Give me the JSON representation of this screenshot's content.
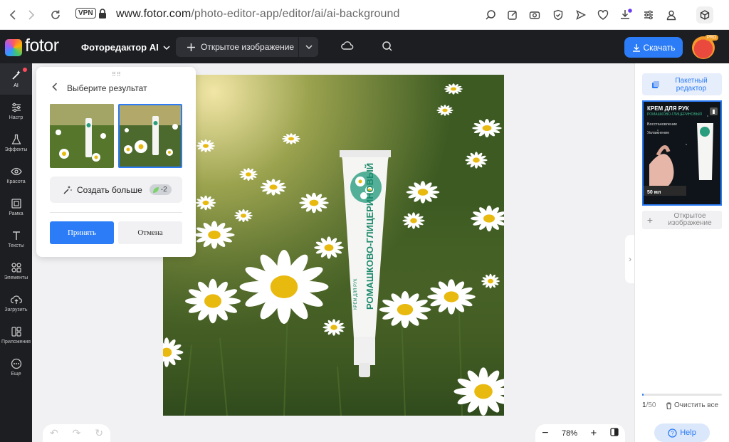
{
  "browser": {
    "vpn_label": "VPN",
    "url_host": "www.fotor.com",
    "url_path": "/photo-editor-app/editor/ai/ai-background"
  },
  "app": {
    "logo_text": "fotor",
    "editor_menu": "Фоторедактор AI",
    "open_image": "Открытое изображение",
    "download": "Скачать",
    "pro_badge": "PRO"
  },
  "tools": [
    {
      "label": "AI",
      "icon": "magic-wand-icon"
    },
    {
      "label": "Настр",
      "icon": "sliders-icon"
    },
    {
      "label": "Эффекты",
      "icon": "flask-icon"
    },
    {
      "label": "Красота",
      "icon": "eye-icon"
    },
    {
      "label": "Рамка",
      "icon": "frame-icon"
    },
    {
      "label": "Тексты",
      "icon": "text-icon"
    },
    {
      "label": "Элементы",
      "icon": "shapes-icon"
    },
    {
      "label": "Загрузить",
      "icon": "upload-cloud-icon"
    },
    {
      "label": "Приложения",
      "icon": "apps-icon"
    },
    {
      "label": "Еще",
      "icon": "more-icon"
    }
  ],
  "panel": {
    "title": "Выберите результат",
    "generate_more": "Создать больше",
    "credits": "-2",
    "accept": "Принять",
    "cancel": "Отмена"
  },
  "product": {
    "tube_small": "КРЕМ ДЛЯ РУК",
    "tube_main": "РОМАШКОВО-ГЛИЦЕРИНОВЫЙ"
  },
  "zoom": {
    "value": "78%"
  },
  "right_panel": {
    "batch_editor": "Пакетный редактор",
    "card_title": "КРЕМ ДЛЯ РУК",
    "card_subtitle": "РОМАШКОВО-ГЛИЦЕРИНОВЫЙ",
    "card_feature_1": "Восстановление",
    "card_feature_2": "Увлажнение",
    "card_volume": "50 мл",
    "open_image": "Открытое изображение",
    "count_current": "1",
    "count_total": "/50",
    "progress": 0.02,
    "clear_all": "Очистить все",
    "help": "Help"
  },
  "colors": {
    "accent": "#2b7cf6",
    "topbar": "#1d1e22"
  }
}
